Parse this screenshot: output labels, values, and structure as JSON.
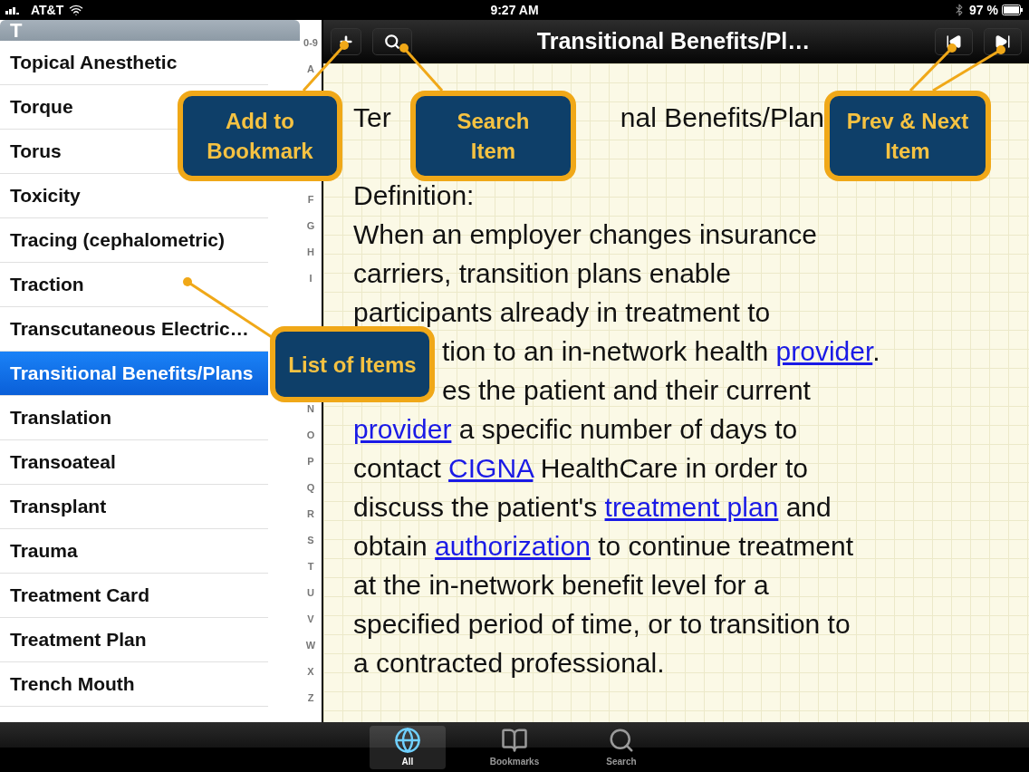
{
  "status_bar": {
    "carrier": "AT&T",
    "time": "9:27 AM",
    "battery": "97 %"
  },
  "sidebar": {
    "section_header": "T",
    "items": [
      {
        "label": "Topical Anesthetic",
        "selected": false
      },
      {
        "label": "Torque",
        "selected": false
      },
      {
        "label": "Torus",
        "selected": false
      },
      {
        "label": "Toxicity",
        "selected": false
      },
      {
        "label": "Tracing (cephalometric)",
        "selected": false
      },
      {
        "label": "Traction",
        "selected": false
      },
      {
        "label": "Transcutaneous Electric…",
        "selected": false
      },
      {
        "label": "Transitional Benefits/Plans",
        "selected": true
      },
      {
        "label": "Translation",
        "selected": false
      },
      {
        "label": "Transoateal",
        "selected": false
      },
      {
        "label": "Transplant",
        "selected": false
      },
      {
        "label": "Trauma",
        "selected": false
      },
      {
        "label": "Treatment Card",
        "selected": false
      },
      {
        "label": "Treatment Plan",
        "selected": false
      },
      {
        "label": "Trench Mouth",
        "selected": false
      }
    ],
    "index_groups": [
      [
        "0-9",
        "A"
      ],
      [
        "F",
        "G",
        "H",
        "I"
      ],
      [
        "N",
        "O",
        "P",
        "Q",
        "R",
        "S",
        "T",
        "U",
        "V",
        "W",
        "X",
        "Z"
      ]
    ]
  },
  "toolbar": {
    "title": "Transitional Benefits/Pl…"
  },
  "article": {
    "heading": [
      "Ter",
      "nal Benefits/Plan"
    ],
    "lines": [
      {
        "kind": "full",
        "segments": [
          {
            "text": "Definition:",
            "link": false
          }
        ]
      },
      {
        "kind": "full",
        "segments": [
          {
            "text": "When an employer changes insurance",
            "link": false
          }
        ]
      },
      {
        "kind": "full",
        "segments": [
          {
            "text": "carriers, transition plans enable",
            "link": false
          }
        ]
      },
      {
        "kind": "full",
        "segments": [
          {
            "text": "participants already in treatment to",
            "link": false
          }
        ]
      },
      {
        "kind": "continued",
        "segments": [
          {
            "text": "tion to an in-network health ",
            "link": false
          },
          {
            "text": "provider",
            "link": true
          },
          {
            "text": ".",
            "link": false
          }
        ]
      },
      {
        "kind": "continued",
        "segments": [
          {
            "text": "es the patient and their current",
            "link": false
          }
        ]
      },
      {
        "kind": "full",
        "segments": [
          {
            "text": "provider",
            "link": true
          },
          {
            "text": " a specific number of days to",
            "link": false
          }
        ]
      },
      {
        "kind": "full",
        "segments": [
          {
            "text": "contact ",
            "link": false
          },
          {
            "text": "CIGNA",
            "link": true
          },
          {
            "text": " HealthCare in order to",
            "link": false
          }
        ]
      },
      {
        "kind": "full",
        "segments": [
          {
            "text": "discuss the patient's ",
            "link": false
          },
          {
            "text": "treatment plan",
            "link": true
          },
          {
            "text": " and",
            "link": false
          }
        ]
      },
      {
        "kind": "full",
        "segments": [
          {
            "text": "obtain ",
            "link": false
          },
          {
            "text": "authorization",
            "link": true
          },
          {
            "text": " to continue treatment",
            "link": false
          }
        ]
      },
      {
        "kind": "full",
        "segments": [
          {
            "text": "at the in-network benefit level for a",
            "link": false
          }
        ]
      },
      {
        "kind": "full",
        "segments": [
          {
            "text": "specified period of time, or to transition to",
            "link": false
          }
        ]
      },
      {
        "kind": "full",
        "segments": [
          {
            "text": "a contracted professional.",
            "link": false
          }
        ]
      }
    ]
  },
  "callouts": [
    {
      "kind": "bookmark",
      "lines": [
        "Add to",
        "Bookmark"
      ]
    },
    {
      "kind": "search",
      "lines": [
        "Search",
        "Item"
      ]
    },
    {
      "kind": "prev-next",
      "lines": [
        "Prev & Next",
        "Item"
      ]
    },
    {
      "kind": "list",
      "lines": [
        "List of Items"
      ]
    }
  ],
  "tab_bar": {
    "tabs": [
      {
        "kind": "globe",
        "label": "All",
        "selected": true
      },
      {
        "kind": "book",
        "label": "Bookmarks",
        "selected": false
      },
      {
        "kind": "search",
        "label": "Search",
        "selected": false
      }
    ]
  }
}
